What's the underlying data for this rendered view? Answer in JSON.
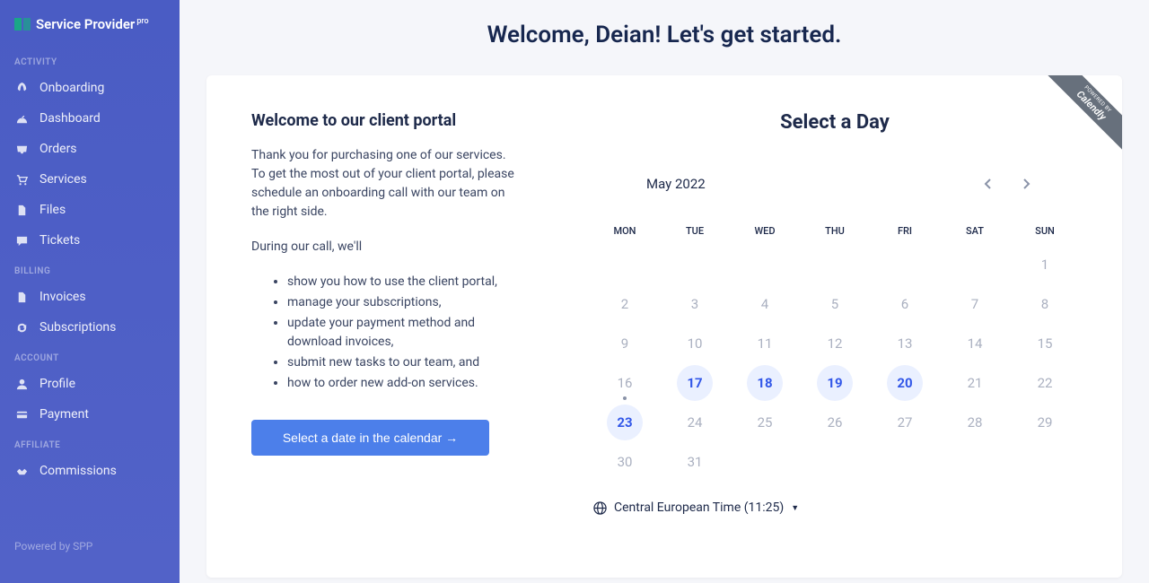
{
  "logo": {
    "text": "Service Provider",
    "sup": "pro"
  },
  "sections": [
    {
      "label": "ACTIVITY",
      "items": [
        {
          "key": "onboarding",
          "label": "Onboarding",
          "icon": "rocket"
        },
        {
          "key": "dashboard",
          "label": "Dashboard",
          "icon": "gauge"
        },
        {
          "key": "orders",
          "label": "Orders",
          "icon": "inbox"
        },
        {
          "key": "services",
          "label": "Services",
          "icon": "cart"
        },
        {
          "key": "files",
          "label": "Files",
          "icon": "file"
        },
        {
          "key": "tickets",
          "label": "Tickets",
          "icon": "chat"
        }
      ]
    },
    {
      "label": "BILLING",
      "items": [
        {
          "key": "invoices",
          "label": "Invoices",
          "icon": "file"
        },
        {
          "key": "subscriptions",
          "label": "Subscriptions",
          "icon": "refresh"
        }
      ]
    },
    {
      "label": "ACCOUNT",
      "items": [
        {
          "key": "profile",
          "label": "Profile",
          "icon": "user"
        },
        {
          "key": "payment",
          "label": "Payment",
          "icon": "card"
        }
      ]
    },
    {
      "label": "AFFILIATE",
      "items": [
        {
          "key": "commissions",
          "label": "Commissions",
          "icon": "handshake"
        }
      ]
    }
  ],
  "powered": "Powered by SPP",
  "welcome": "Welcome, Deian! Let's get started.",
  "portal": {
    "title": "Welcome to our client portal",
    "p1": "Thank you for purchasing one of our services. To get the most out of your client portal, please schedule an onboarding call with our team on the right side.",
    "p2": "During our call, we'll",
    "bullets": [
      "show you how to use the client portal,",
      "manage your subscriptions,",
      "update your payment method and download invoices,",
      "submit new tasks to our team, and",
      "how to order new add-on services."
    ],
    "cta": "Select a date in the calendar →"
  },
  "calendar": {
    "title": "Select a Day",
    "badge_line1": "POWERED BY",
    "badge_line2": "Calendly",
    "month": "May 2022",
    "dows": [
      "MON",
      "TUE",
      "WED",
      "THU",
      "FRI",
      "SAT",
      "SUN"
    ],
    "lead_blanks": 6,
    "days": [
      {
        "n": 1
      },
      {
        "n": 2
      },
      {
        "n": 3
      },
      {
        "n": 4
      },
      {
        "n": 5
      },
      {
        "n": 6
      },
      {
        "n": 7
      },
      {
        "n": 8
      },
      {
        "n": 9
      },
      {
        "n": 10
      },
      {
        "n": 11
      },
      {
        "n": 12
      },
      {
        "n": 13
      },
      {
        "n": 14
      },
      {
        "n": 15
      },
      {
        "n": 16,
        "today": true
      },
      {
        "n": 17,
        "avail": true
      },
      {
        "n": 18,
        "avail": true
      },
      {
        "n": 19,
        "avail": true
      },
      {
        "n": 20,
        "avail": true
      },
      {
        "n": 21
      },
      {
        "n": 22
      },
      {
        "n": 23,
        "avail": true
      },
      {
        "n": 24
      },
      {
        "n": 25
      },
      {
        "n": 26
      },
      {
        "n": 27
      },
      {
        "n": 28
      },
      {
        "n": 29
      },
      {
        "n": 30
      },
      {
        "n": 31
      }
    ],
    "tz": "Central European Time (11:25)"
  }
}
